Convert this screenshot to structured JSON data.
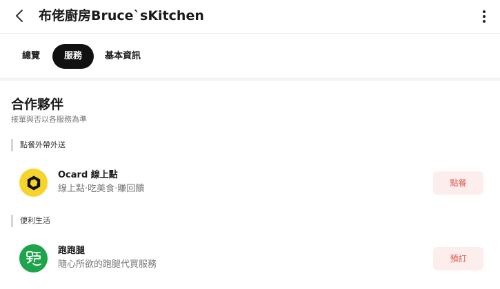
{
  "header": {
    "title": "布佬廚房Bruce`sKitchen",
    "back_icon": "chevron-left-icon",
    "more_icon": "more-vertical-icon"
  },
  "tabs": [
    {
      "label": "總覽",
      "active": false
    },
    {
      "label": "服務",
      "active": true
    },
    {
      "label": "基本資訊",
      "active": false
    }
  ],
  "section": {
    "title": "合作夥伴",
    "subtitle": "接單與否以各服務為準"
  },
  "groups": [
    {
      "label": "點餐外帶外送",
      "partners": [
        {
          "name": "Ocard 線上點",
          "desc": "線上點·吃美食·賺回饋",
          "action": "點餐",
          "logo_color": "#f6d32d",
          "logo_icon": "ocard-logo-icon"
        }
      ]
    },
    {
      "label": "便利生活",
      "partners": [
        {
          "name": "跑跑腿",
          "desc": "隨心所欲的跑腿代買服務",
          "action": "預訂",
          "logo_color": "#1ea44a",
          "logo_icon": "runner-logo-icon"
        }
      ]
    }
  ],
  "colors": {
    "accent_text": "#e0564b",
    "accent_bg": "#fdeeee",
    "active_tab_bg": "#111111"
  }
}
